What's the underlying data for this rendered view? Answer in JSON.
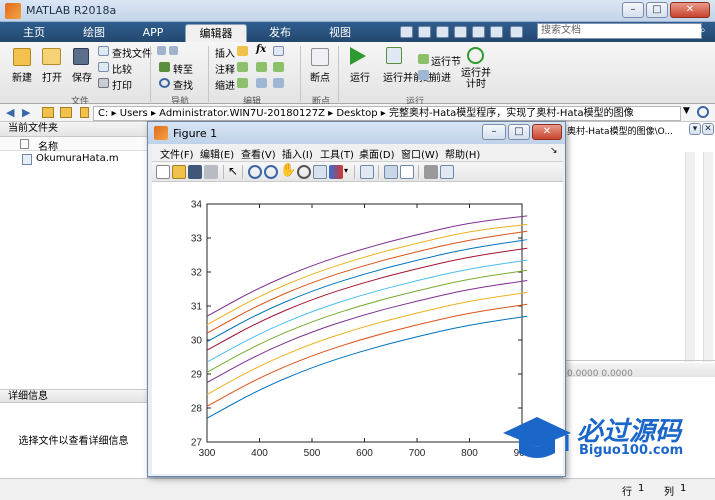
{
  "window": {
    "title": "MATLAB R2018a"
  },
  "tabs": [
    "主页",
    "绘图",
    "APP",
    "编辑器",
    "发布",
    "视图"
  ],
  "search": {
    "placeholder": "搜索文档"
  },
  "ribbon": {
    "file_group": {
      "label": "文件",
      "new": "新建",
      "open": "打开",
      "save": "保存",
      "find_files": "查找文件",
      "compare": "比较",
      "print": "打印"
    },
    "nav_group": {
      "label": "导航",
      "goto": "转至",
      "find": "查找"
    },
    "edit_group": {
      "label": "编辑",
      "insert": "插入",
      "comment": "注释",
      "indent": "缩进",
      "fx": "fx"
    },
    "breakpoints_group": {
      "label": "断点",
      "breakpoints": "断点"
    },
    "run_group": {
      "label": "运行",
      "run": "运行",
      "run_advance": "运行并前进",
      "run_section": "运行节",
      "advance": "前进",
      "run_time": "运行并计时"
    }
  },
  "address": {
    "segments": [
      "C:",
      "Users",
      "Administrator.WIN7U-20180127Z",
      "Desktop",
      "完整奥村-Hata模型程序，实现了奥村-Hata模型的图像"
    ]
  },
  "left_panel": {
    "title": "当前文件夹",
    "column_name": "名称",
    "file": "OkumuraHata.m",
    "details_title": "详细信息",
    "details_hint": "选择文件以查看详细信息"
  },
  "right_panel": {
    "path_fragment": "奥村-Hata模型的图像\\O...",
    "numbers": "0.0000   0.0000"
  },
  "status": {
    "row_label": "行",
    "row": "1",
    "col_label": "列",
    "col": "1"
  },
  "figure": {
    "title": "Figure 1",
    "menus": [
      "文件(F)",
      "编辑(E)",
      "查看(V)",
      "插入(I)",
      "工具(T)",
      "桌面(D)",
      "窗口(W)",
      "帮助(H)"
    ]
  },
  "watermark": {
    "text": "必过源码",
    "url": "Biguo100.com"
  },
  "chart_data": {
    "type": "line",
    "xlim": [
      300,
      900
    ],
    "ylim": [
      27,
      34
    ],
    "xticks": [
      300,
      400,
      500,
      600,
      700,
      800,
      900
    ],
    "yticks": [
      27,
      28,
      29,
      30,
      31,
      32,
      33,
      34
    ],
    "x": [
      300,
      400,
      500,
      600,
      700,
      800,
      910
    ],
    "series": [
      {
        "color": "#0072BD",
        "values": [
          27.7,
          28.55,
          29.2,
          29.7,
          30.1,
          30.45,
          30.7
        ]
      },
      {
        "color": "#D95319",
        "values": [
          28.05,
          28.9,
          29.55,
          30.05,
          30.45,
          30.8,
          31.05
        ]
      },
      {
        "color": "#EDB120",
        "values": [
          28.4,
          29.25,
          29.9,
          30.4,
          30.8,
          31.15,
          31.4
        ]
      },
      {
        "color": "#7E2F8E",
        "values": [
          28.75,
          29.6,
          30.25,
          30.75,
          31.15,
          31.5,
          31.75
        ]
      },
      {
        "color": "#77AC30",
        "values": [
          29.05,
          29.9,
          30.55,
          31.05,
          31.45,
          31.8,
          32.05
        ]
      },
      {
        "color": "#4DBEEE",
        "values": [
          29.35,
          30.2,
          30.85,
          31.35,
          31.75,
          32.1,
          32.35
        ]
      },
      {
        "color": "#A2142F",
        "values": [
          29.7,
          30.55,
          31.2,
          31.7,
          32.1,
          32.45,
          32.7
        ]
      },
      {
        "color": "#0072BD",
        "values": [
          29.95,
          30.8,
          31.45,
          31.95,
          32.35,
          32.7,
          32.95
        ]
      },
      {
        "color": "#D95319",
        "values": [
          30.2,
          31.05,
          31.7,
          32.2,
          32.6,
          32.95,
          33.2
        ]
      },
      {
        "color": "#EDB120",
        "values": [
          30.45,
          31.3,
          31.95,
          32.45,
          32.85,
          33.2,
          33.4
        ]
      },
      {
        "color": "#7E2F8E",
        "values": [
          30.7,
          31.55,
          32.2,
          32.7,
          33.1,
          33.45,
          33.65
        ]
      }
    ]
  }
}
